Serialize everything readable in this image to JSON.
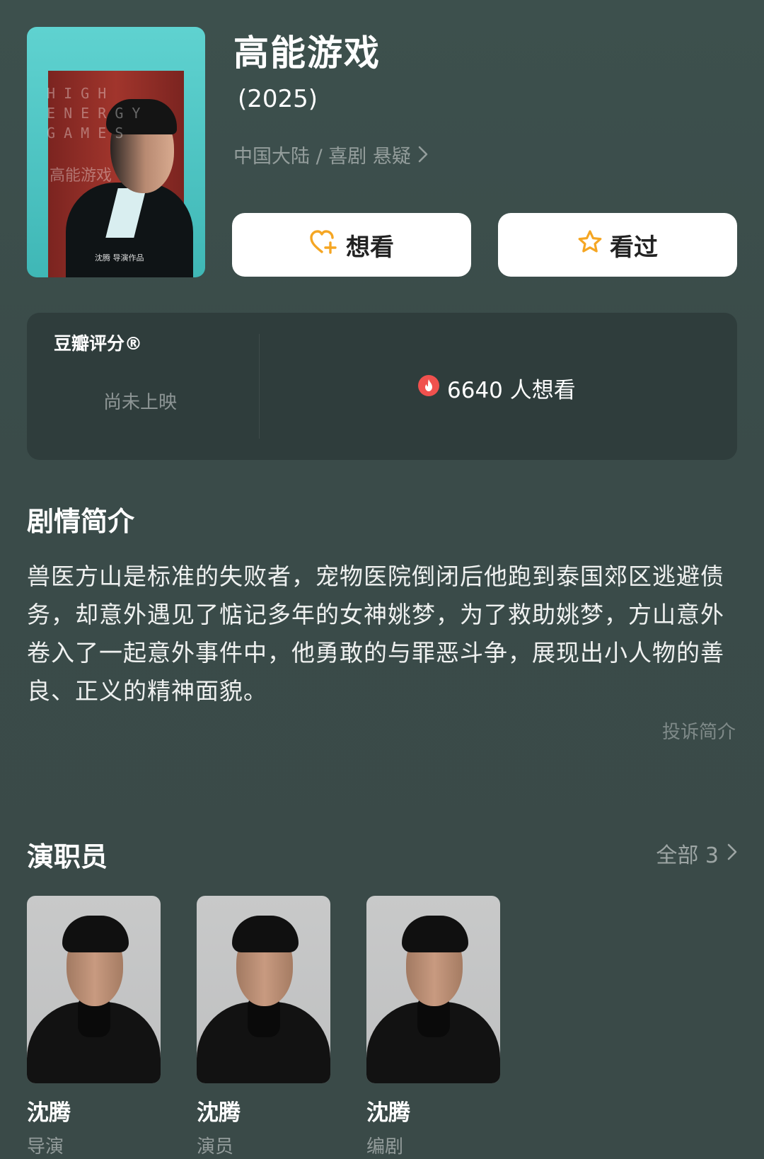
{
  "movie": {
    "title": "高能游戏",
    "year": "(2025)",
    "meta": "中国大陆 / 喜剧 悬疑",
    "poster": {
      "letters": [
        "H  I  G  H",
        "E N E R G Y",
        "G  A  M  E S"
      ],
      "cn_title": "高能游戏",
      "credit": "沈腾 导演作品"
    }
  },
  "actions": {
    "want_label": "想看",
    "seen_label": "看过"
  },
  "rating": {
    "label": "豆瓣评分®",
    "status": "尚未上映",
    "want_count": "6640 人想看"
  },
  "synopsis": {
    "heading": "剧情简介",
    "text": "兽医方山是标准的失败者，宠物医院倒闭后他跑到泰国郊区逃避债务，却意外遇见了惦记多年的女神姚梦，为了救助姚梦，方山意外卷入了一起意外事件中，他勇敢的与罪恶斗争，展现出小人物的善良、正义的精神面貌。",
    "report_label": "投诉简介"
  },
  "cast": {
    "heading": "演职员",
    "all_label": "全部 3",
    "members": [
      {
        "name": "沈腾",
        "role": "导演"
      },
      {
        "name": "沈腾",
        "role": "演员"
      },
      {
        "name": "沈腾",
        "role": "编剧"
      }
    ]
  },
  "colors": {
    "background": "#3a4b49",
    "card": "#2f3d3c",
    "accent_orange": "#f5a623",
    "fire_red": "#f0514e"
  },
  "icons": [
    "heart-plus-icon",
    "star-icon",
    "fire-icon",
    "chevron-right-icon"
  ]
}
